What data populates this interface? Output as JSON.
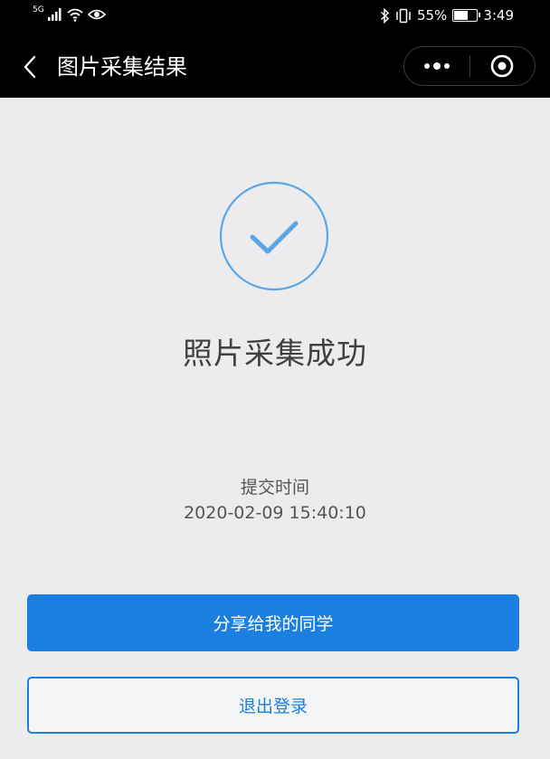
{
  "status_bar": {
    "network": "5G",
    "battery_percent": "55%",
    "battery_level": 0.55,
    "time": "3:49",
    "icons": [
      "signal-icon",
      "wifi-icon",
      "eye-icon",
      "bluetooth-icon",
      "vibrate-icon",
      "battery-icon"
    ]
  },
  "nav": {
    "title": "图片采集结果",
    "icons": [
      "back-arrow-icon",
      "more-dots-icon",
      "target-circle-icon"
    ]
  },
  "result": {
    "icon": "check-circle-icon",
    "title": "照片采集成功",
    "submit_label": "提交时间",
    "submit_time": "2020-02-09 15:40:10"
  },
  "actions": {
    "share_label": "分享给我的同学",
    "logout_label": "退出登录"
  },
  "colors": {
    "accent": "#1b7fe0",
    "icon_blue": "#5aa6e4",
    "background": "#ececef",
    "header": "#000000"
  }
}
